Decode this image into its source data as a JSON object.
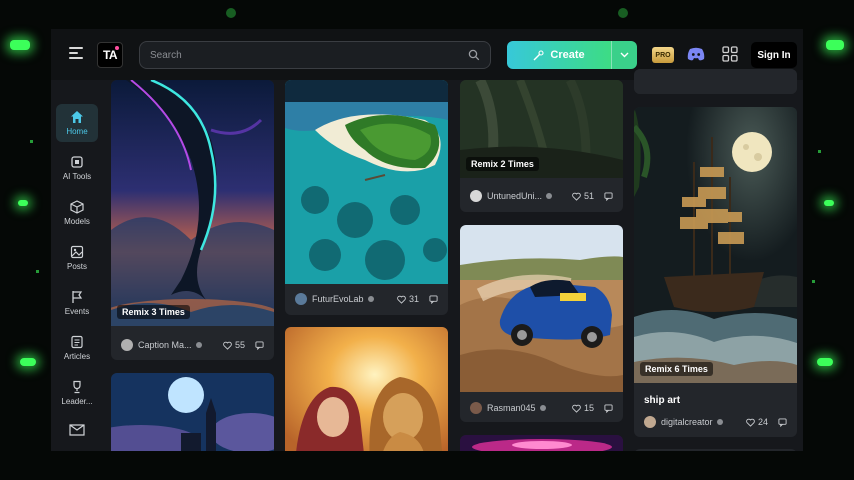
{
  "header": {
    "logo_text": "TA",
    "search_placeholder": "Search",
    "create_label": "Create",
    "pro_label": "PRO",
    "signin_label": "Sign In"
  },
  "sidebar": {
    "items": [
      {
        "label": "Home",
        "icon": "home-icon",
        "active": true
      },
      {
        "label": "AI Tools",
        "icon": "ai-tools-icon"
      },
      {
        "label": "Models",
        "icon": "cube-icon"
      },
      {
        "label": "Posts",
        "icon": "image-icon"
      },
      {
        "label": "Events",
        "icon": "flag-icon"
      },
      {
        "label": "Articles",
        "icon": "article-icon"
      },
      {
        "label": "Leader...",
        "icon": "trophy-icon"
      }
    ]
  },
  "cards": {
    "whale": {
      "remix": "Remix 3 Times",
      "user": "Caption Ma...",
      "likes": "55"
    },
    "island": {
      "user": "FuturEvoLab",
      "likes": "31"
    },
    "forest": {
      "remix": "Remix 2 Times",
      "user": "UntunedUni...",
      "likes": "51"
    },
    "rally": {
      "user": "Rasman045",
      "likes": "15"
    },
    "ship": {
      "remix": "Remix 6 Times",
      "title": "ship art",
      "user": "digitalcreator",
      "likes": "24"
    }
  },
  "colors": {
    "accent": "#4cc9e8",
    "create_gradient_start": "#37c8d9",
    "create_gradient_end": "#3ddc84",
    "background_glow": "#3cff5a"
  }
}
